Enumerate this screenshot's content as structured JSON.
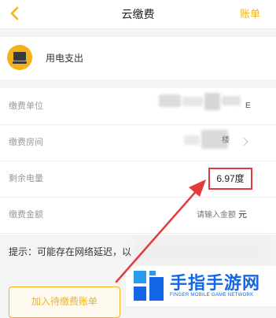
{
  "header": {
    "title": "云缴费",
    "right_link": "账单"
  },
  "service": {
    "name": "用电支出",
    "icon": "tv-icon"
  },
  "form": {
    "unit_label": "缴费单位",
    "unit_value_partial": "E",
    "room_label": "缴费房间",
    "room_value_partial": "楼",
    "remaining_label": "剩余电量",
    "remaining_value": "6.97度",
    "amount_label": "缴费金额",
    "amount_placeholder": "请输入金额",
    "amount_unit": "元"
  },
  "tip": "提示：可能存在网络延迟，以",
  "bottom": {
    "add_button": "加入待缴费账单"
  },
  "watermark": {
    "title": "手指手游网",
    "subtitle": "FINGER MOBILE GAME NETWORK"
  },
  "colors": {
    "accent": "#f3b21a",
    "highlight": "#e33b3b",
    "watermark": "#1366e6"
  }
}
